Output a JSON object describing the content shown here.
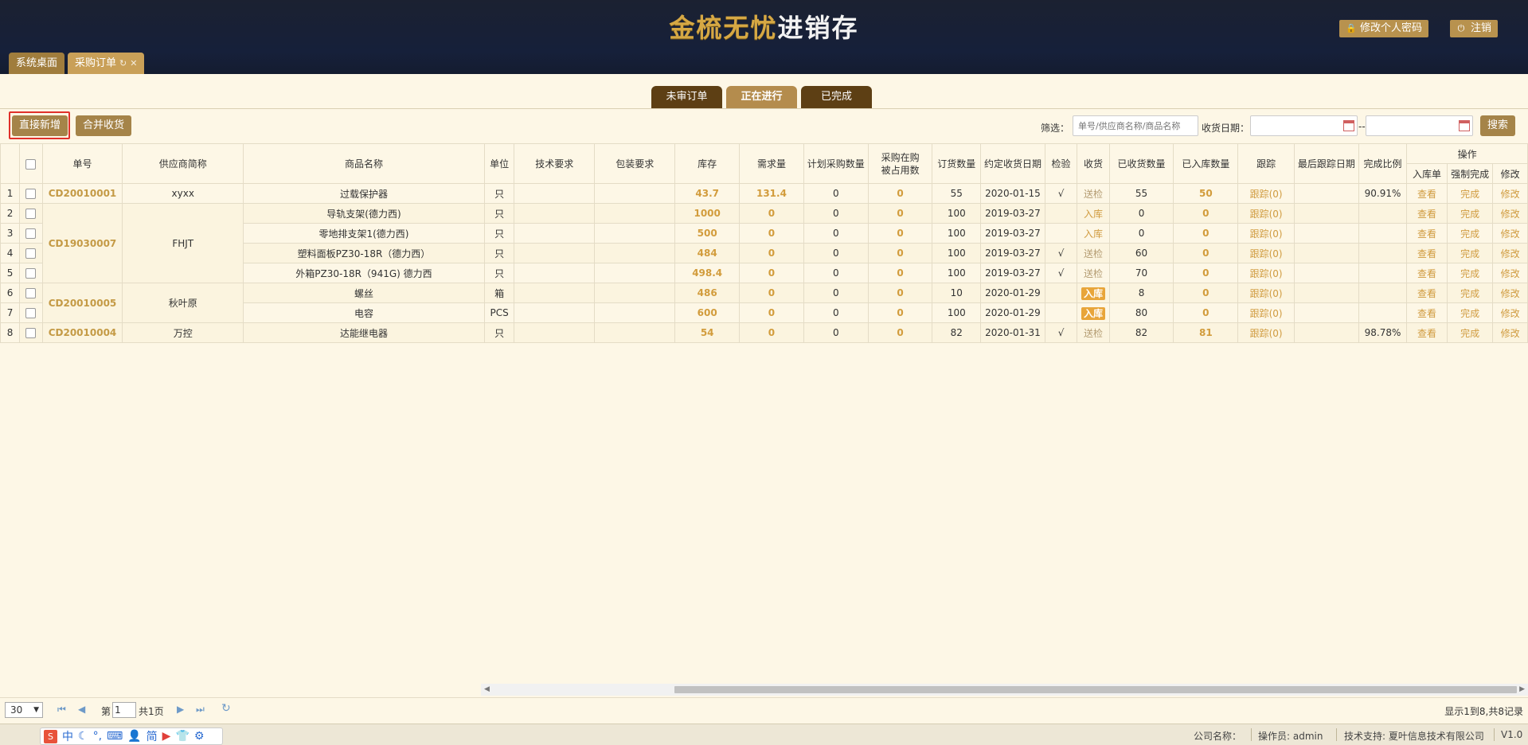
{
  "brand": {
    "part1": "金梳无忧",
    "part2": "进销存",
    "accent": "#d6a844"
  },
  "header": {
    "change_password": "修改个人密码",
    "logout": "注销"
  },
  "top_tabs": [
    {
      "label": "系统桌面"
    },
    {
      "label": "采购订单"
    }
  ],
  "sub_tabs": [
    {
      "label": "未审订单"
    },
    {
      "label": "正在进行"
    },
    {
      "label": "已完成"
    }
  ],
  "toolbar": {
    "new_direct": "直接新增",
    "merge_receive": "合并收货",
    "filter_label": "筛选：",
    "filter_placeholder": "单号/供应商名称/商品名称",
    "date_label": "收货日期：",
    "date_sep": "--",
    "search": "搜索"
  },
  "table": {
    "headers": {
      "order_no": "单号",
      "supplier": "供应商简称",
      "product": "商品名称",
      "unit": "单位",
      "tech": "技术要求",
      "pack": "包装要求",
      "stock": "库存",
      "demand": "需求量",
      "plan": "计划采购数量",
      "occupied_l1": "采购在购",
      "occupied_l2": "被占用数",
      "order_qty": "订货数量",
      "due_date": "约定收货日期",
      "inspect": "检验",
      "receive": "收货",
      "received": "已收货数量",
      "stored": "已入库数量",
      "track": "跟踪",
      "last_track": "最后跟踪日期",
      "ratio": "完成比例",
      "ops": "操作",
      "op_view": "入库单",
      "op_force": "强制完成",
      "op_edit": "修改"
    },
    "orders": [
      {
        "no": "CD20010001",
        "supplier": "xyxx"
      },
      {
        "no": "CD19030007",
        "supplier": "FHJT"
      },
      {
        "no": "CD20010005",
        "supplier": "秋叶原"
      },
      {
        "no": "CD20010004",
        "supplier": "万控"
      }
    ],
    "rows": [
      {
        "idx": "1",
        "product": "过载保护器",
        "unit": "只",
        "stock": "43.7",
        "demand": "131.4",
        "plan": "0",
        "occ": "0",
        "qty": "55",
        "date": "2020-01-15",
        "inspect": "√",
        "recv": "送检",
        "received": "55",
        "stored": "50",
        "track": "跟踪(0)",
        "ratio": "90.91%",
        "view": "查看",
        "force": "完成",
        "edit": "修改"
      },
      {
        "idx": "2",
        "product": "导轨支架(德力西)",
        "unit": "只",
        "stock": "1000",
        "demand": "0",
        "plan": "0",
        "occ": "0",
        "qty": "100",
        "date": "2019-03-27",
        "inspect": "",
        "recv": "入库",
        "received": "0",
        "stored": "0",
        "track": "跟踪(0)",
        "ratio": "",
        "view": "查看",
        "force": "完成",
        "edit": "修改"
      },
      {
        "idx": "3",
        "product": "零地排支架1(德力西)",
        "unit": "只",
        "stock": "500",
        "demand": "0",
        "plan": "0",
        "occ": "0",
        "qty": "100",
        "date": "2019-03-27",
        "inspect": "",
        "recv": "入库",
        "received": "0",
        "stored": "0",
        "track": "跟踪(0)",
        "ratio": "",
        "view": "查看",
        "force": "完成",
        "edit": "修改"
      },
      {
        "idx": "4",
        "product": "塑料面板PZ30-18R（德力西）",
        "unit": "只",
        "stock": "484",
        "demand": "0",
        "plan": "0",
        "occ": "0",
        "qty": "100",
        "date": "2019-03-27",
        "inspect": "√",
        "recv": "送检",
        "received": "60",
        "stored": "0",
        "track": "跟踪(0)",
        "ratio": "",
        "view": "查看",
        "force": "完成",
        "edit": "修改"
      },
      {
        "idx": "5",
        "product": "外箱PZ30-18R（941G) 德力西",
        "unit": "只",
        "stock": "498.4",
        "demand": "0",
        "plan": "0",
        "occ": "0",
        "qty": "100",
        "date": "2019-03-27",
        "inspect": "√",
        "recv": "送检",
        "received": "70",
        "stored": "0",
        "track": "跟踪(0)",
        "ratio": "",
        "view": "查看",
        "force": "完成",
        "edit": "修改"
      },
      {
        "idx": "6",
        "product": "螺丝",
        "unit": "箱",
        "stock": "486",
        "demand": "0",
        "plan": "0",
        "occ": "0",
        "qty": "10",
        "date": "2020-01-29",
        "inspect": "",
        "recv": "入库",
        "received": "8",
        "stored": "0",
        "track": "跟踪(0)",
        "ratio": "",
        "view": "查看",
        "force": "完成",
        "edit": "修改"
      },
      {
        "idx": "7",
        "product": "电容",
        "unit": "PCS",
        "stock": "600",
        "demand": "0",
        "plan": "0",
        "occ": "0",
        "qty": "100",
        "date": "2020-01-29",
        "inspect": "",
        "recv": "入库",
        "received": "80",
        "stored": "0",
        "track": "跟踪(0)",
        "ratio": "",
        "view": "查看",
        "force": "完成",
        "edit": "修改"
      },
      {
        "idx": "8",
        "product": "达能继电器",
        "unit": "只",
        "stock": "54",
        "demand": "0",
        "plan": "0",
        "occ": "0",
        "qty": "82",
        "date": "2020-01-31",
        "inspect": "√",
        "recv": "送检",
        "received": "82",
        "stored": "81",
        "track": "跟踪(0)",
        "ratio": "98.78%",
        "view": "查看",
        "force": "完成",
        "edit": "修改"
      }
    ]
  },
  "pager": {
    "page_size": "30",
    "page_prefix": "第",
    "page_value": "1",
    "page_total": "共1页",
    "summary": "显示1到8,共8记录"
  },
  "footer": {
    "company_label": "公司名称：",
    "operator": "操作员: admin",
    "support": "技术支持: 夏叶信息技术有限公司",
    "version": "V1.0",
    "ime_chars": [
      "中",
      "简"
    ]
  }
}
